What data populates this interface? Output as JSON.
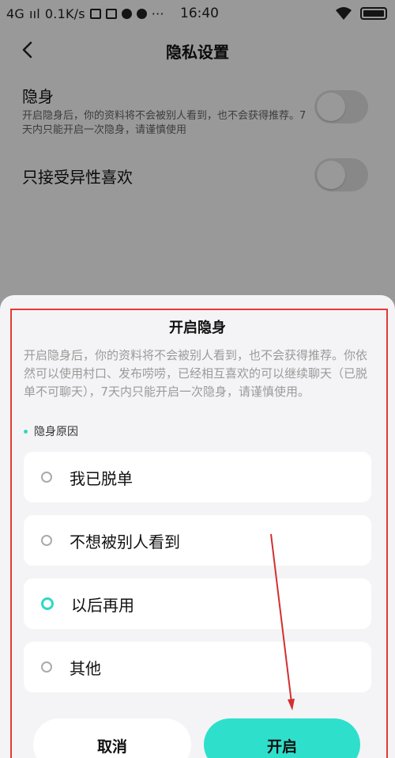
{
  "status_bar": {
    "network": "4G",
    "signal": "ııl",
    "speed": "0.1K/s",
    "more": "···",
    "time": "16:40"
  },
  "nav": {
    "title": "隐私设置"
  },
  "settings": [
    {
      "title": "隐身",
      "desc": "开启隐身后，你的资料将不会被别人看到，也不会获得推荐。7天内只能开启一次隐身，请谨慎使用"
    },
    {
      "title": "只接受异性喜欢",
      "desc": ""
    }
  ],
  "sheet": {
    "title": "开启隐身",
    "desc": "开启隐身后，你的资料将不会被别人看到，也不会获得推荐。你依然可以使用村口、发布唠唠，已经相互喜欢的可以继续聊天（已脱单不可聊天），7天内只能开启一次隐身，请谨慎使用。",
    "reason_label": "隐身原因",
    "options": [
      {
        "label": "我已脱单",
        "selected": false
      },
      {
        "label": "不想被别人看到",
        "selected": false
      },
      {
        "label": "以后再用",
        "selected": true
      },
      {
        "label": "其他",
        "selected": false
      }
    ],
    "cancel_label": "取消",
    "open_label": "开启"
  },
  "colors": {
    "accent": "#2ee0cb",
    "highlight_border": "#e53935",
    "arrow": "#d32f2f"
  }
}
